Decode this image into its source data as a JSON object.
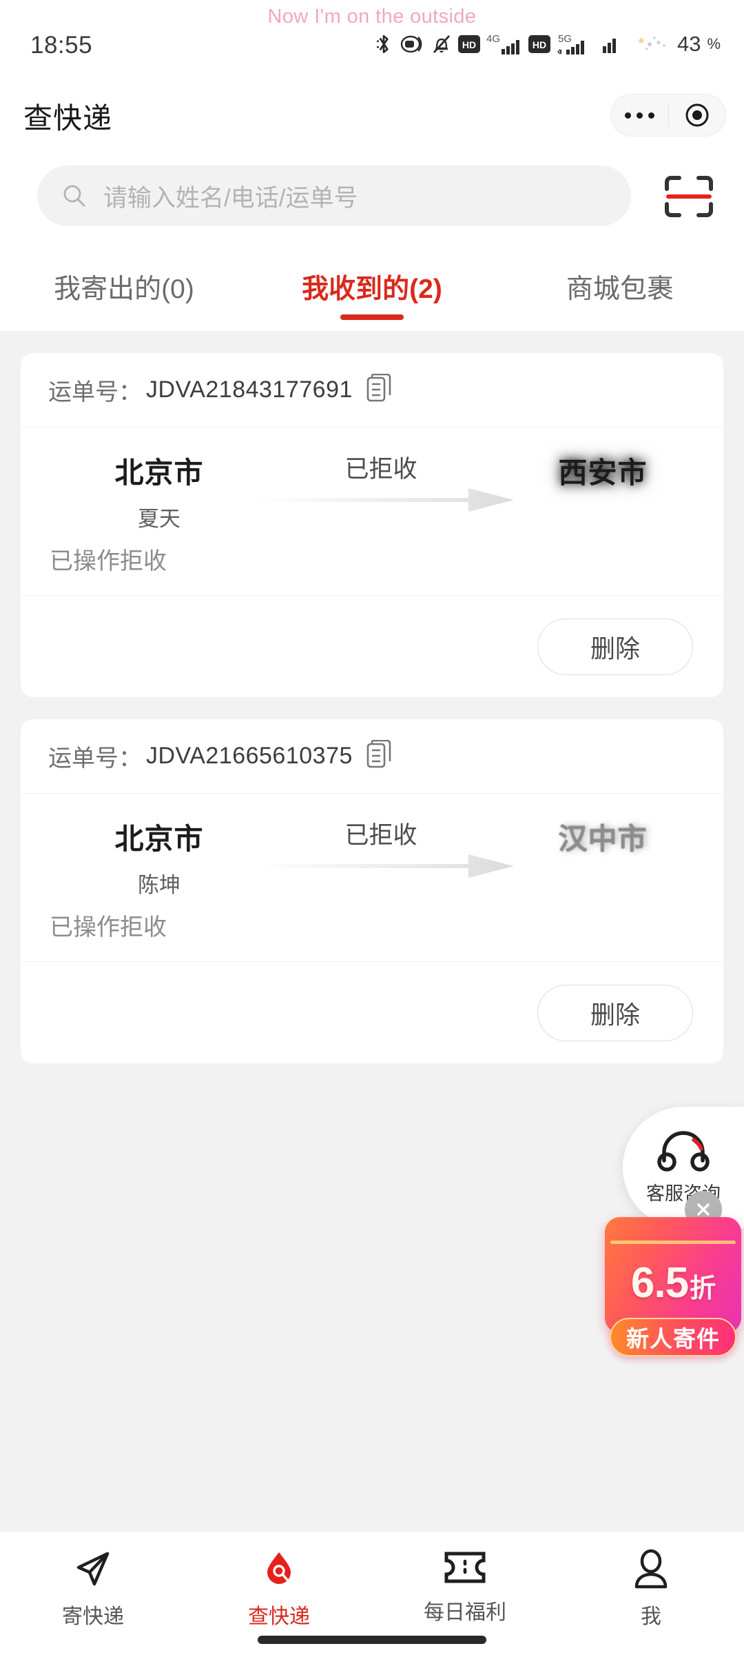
{
  "theme": {
    "accent": "#d9291c",
    "page_bg": "#f2f2f2",
    "card_bg": "#ffffff"
  },
  "status_bar": {
    "lyric": "Now I'm on the outside",
    "time": "18:55",
    "battery_percent": "43",
    "battery_unit": "%",
    "icons": [
      "bluetooth-icon",
      "headset-icon",
      "mute-bell-icon",
      "hd-icon",
      "4g-signal-icon",
      "hd-icon",
      "5g-signal-icon",
      "signal-icon",
      "do-not-disturb-moon-icon"
    ],
    "network_4g": "4G",
    "network_5g": "5G",
    "hd_label": "HD"
  },
  "title_bar": {
    "title": "查快递",
    "capsule_more": "more-options",
    "capsule_target": "mini-program-menu"
  },
  "search": {
    "placeholder": "请输入姓名/电话/运单号",
    "icon": "search-icon",
    "scan_icon": "scan-code-icon"
  },
  "tabs": [
    {
      "label": "我寄出的(0)",
      "active": false
    },
    {
      "label": "我收到的(2)",
      "active": true
    },
    {
      "label": "商城包裹",
      "active": false
    }
  ],
  "packages": [
    {
      "waybill_label": "运单号：",
      "waybill_no": "JDVA21843177691",
      "copy_icon": "copy-icon",
      "from_city": "北京市",
      "from_name": "夏天",
      "status": "已拒收",
      "to_city": "西安市",
      "sub_status": "已操作拒收",
      "delete_label": "删除"
    },
    {
      "waybill_label": "运单号：",
      "waybill_no": "JDVA21665610375",
      "copy_icon": "copy-icon",
      "from_city": "北京市",
      "from_name": "陈坤",
      "status": "已拒收",
      "to_city": "汉中市",
      "sub_status": "已操作拒收",
      "delete_label": "删除"
    }
  ],
  "customer_service": {
    "label": "客服咨询",
    "icon": "headphones-icon"
  },
  "promo": {
    "amount": "6.5",
    "unit": "折",
    "badge": "新人寄件",
    "close_icon": "close-icon"
  },
  "bottom_nav": [
    {
      "label": "寄快递",
      "icon": "paper-plane-icon",
      "active": false
    },
    {
      "label": "查快递",
      "icon": "search-drop-icon",
      "active": true
    },
    {
      "label": "每日福利",
      "icon": "ticket-icon",
      "active": false
    },
    {
      "label": "我",
      "icon": "person-icon",
      "active": false
    }
  ]
}
